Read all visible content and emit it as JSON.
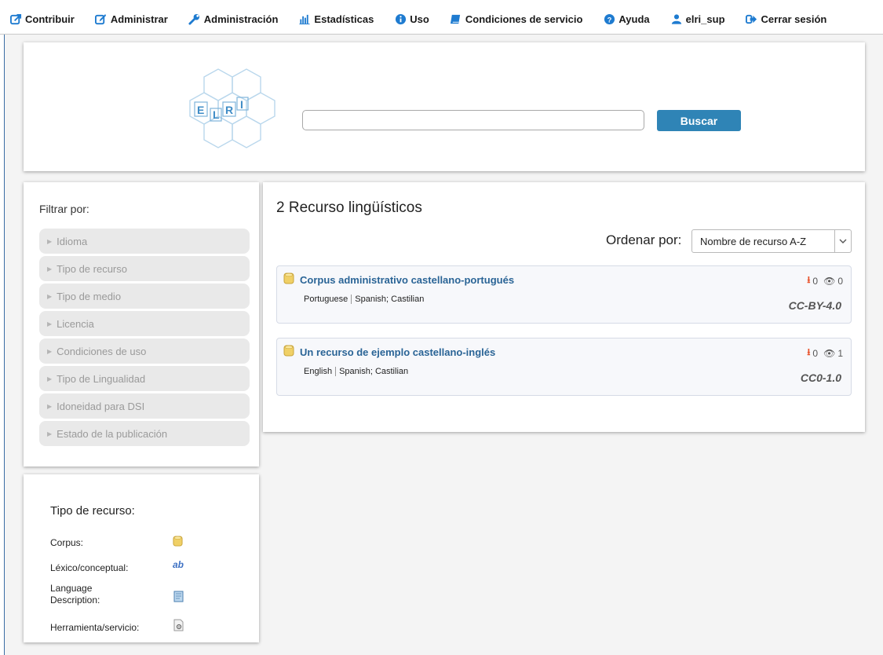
{
  "nav": [
    {
      "icon": "external-edit-icon",
      "label": "Contribuir"
    },
    {
      "icon": "edit-icon",
      "label": "Administrar"
    },
    {
      "icon": "wrench-icon",
      "label": "Administración"
    },
    {
      "icon": "bar-chart-icon",
      "label": "Estadísticas"
    },
    {
      "icon": "info-icon",
      "label": "Uso"
    },
    {
      "icon": "book-icon",
      "label": "Condiciones de servicio"
    },
    {
      "icon": "question-icon",
      "label": "Ayuda"
    },
    {
      "icon": "user-icon",
      "label": "elri_sup"
    },
    {
      "icon": "sign-out-icon",
      "label": "Cerrar sesión"
    }
  ],
  "header": {
    "logo_text": "ELRI",
    "search_value": "",
    "search_button": "Buscar"
  },
  "filter": {
    "title": "Filtrar por:",
    "items": [
      "Idioma",
      "Tipo de recurso",
      "Tipo de medio",
      "Licencia",
      "Condiciones de uso",
      "Tipo de Lingualidad",
      "Idoneidad para DSI",
      "Estado de la publicación"
    ]
  },
  "results": {
    "title": "2 Recurso lingüísticos",
    "sort_label": "Ordenar por:",
    "sort_value": "Nombre de recurso A-Z",
    "items": [
      {
        "title": "Corpus administrativo castellano-portugués",
        "lang1": "Portuguese",
        "lang2": "Spanish; Castilian",
        "downloads": "0",
        "views": "0",
        "license": "CC-BY-4.0"
      },
      {
        "title": "Un recurso de ejemplo castellano-inglés",
        "lang1": "English",
        "lang2": "Spanish; Castilian",
        "downloads": "0",
        "views": "1",
        "license": "CC0-1.0"
      }
    ]
  },
  "legend": {
    "title": "Tipo de recurso:",
    "items": [
      {
        "label": "Corpus:",
        "icon": "corpus-icon"
      },
      {
        "label": "Léxico/conceptual:",
        "icon": "lexical-ab-icon"
      },
      {
        "label": "Language Description:",
        "icon": "language-description-icon"
      },
      {
        "label": "Herramienta/servicio:",
        "icon": "tool-service-icon"
      }
    ]
  },
  "colors": {
    "accent": "#2f84b6",
    "link": "#2a6496",
    "download": "#e8532c"
  }
}
